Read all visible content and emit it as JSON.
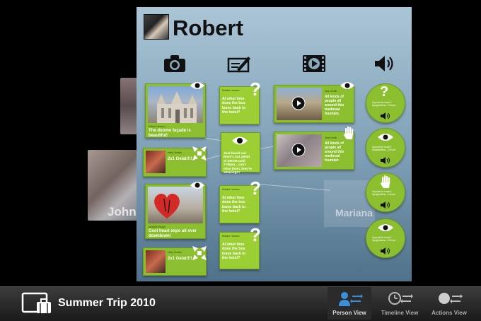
{
  "person": {
    "name": "Robert"
  },
  "ghosts": {
    "john": "John",
    "mariana": "Mariana"
  },
  "column_icons": [
    "camera-icon",
    "note-pen-icon",
    "video-icon",
    "speaker-icon"
  ],
  "photos": [
    {
      "caption": "The duomo façade is beautiful!",
      "author": "Robert Hansen",
      "overlay": "eye-icon"
    },
    {
      "caption": "2x1 Gelati!!!",
      "author": "Helly Ordsen",
      "overlay": "shuffle-icon"
    },
    {
      "caption": "Cool heart expo all over downtown!",
      "author": "Michelle Blacks",
      "overlay": "eye-icon"
    },
    {
      "caption": "2x1 Gelati!!!",
      "author": "Helly Ordsen",
      "overlay": "shuffle-icon"
    }
  ],
  "notes": [
    {
      "header": "Misstel Hansen",
      "text": "At what time does the bus leave back to the hotel?",
      "overlay": "question-icon"
    },
    {
      "header": "",
      "text": "Just found out there's 2x1 gelati at GROM until 7:00pm... can't miss them, they're amazing!!!",
      "overlay": "eye-icon"
    },
    {
      "header": "Misstel Hansen",
      "text": "At what time does the bus leave back to the hotel?",
      "overlay": "question-icon"
    },
    {
      "header": "Misstel Hansen",
      "text": "At what time does the bus leave back to the hotel?",
      "overlay": "question-icon"
    }
  ],
  "videos": [
    {
      "caption": "All kinds of people all around this medieval fountain",
      "author": "Jean Smith",
      "overlay": "eye-icon"
    },
    {
      "caption": "All kinds of people all around this medieval fountain",
      "author": "Jean Smith",
      "overlay": "hand-icon"
    }
  ],
  "audio": [
    {
      "text": "Anyone for lunch? Spaghetteria, 1:30 pm",
      "overlay": "question-icon"
    },
    {
      "text": "Anyone for lunch? Spaghetteria, 1:30 pm",
      "overlay": "eye-icon"
    },
    {
      "text": "Anyone for lunch? Spaghetteria, 1:30 pm",
      "overlay": "hand-icon"
    },
    {
      "text": "Anyone for lunch? Spaghetteria, 1:30 pm",
      "overlay": "eye-icon"
    }
  ],
  "bottom_bar": {
    "trip_title": "Summer Trip 2010",
    "views": [
      "Person View",
      "Timeline View",
      "Actions View"
    ],
    "active_view": "Person View"
  }
}
